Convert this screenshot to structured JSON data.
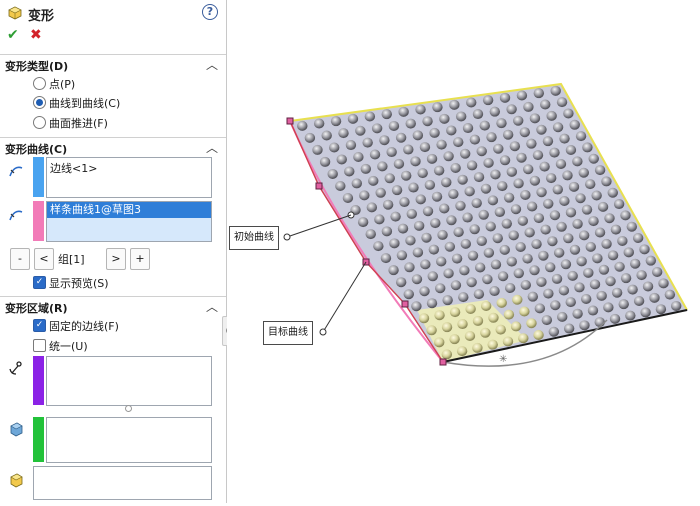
{
  "header": {
    "title": "变形",
    "help_label": "?"
  },
  "actions": {
    "ok_symbol": "✔",
    "cancel_symbol": "✖"
  },
  "deform_type": {
    "heading": "变形类型(D)",
    "options": [
      {
        "label": "点(P)",
        "selected": false
      },
      {
        "label": "曲线到曲线(C)",
        "selected": true
      },
      {
        "label": "曲面推进(F)",
        "selected": false
      }
    ]
  },
  "deform_curves": {
    "heading": "变形曲线(C)",
    "initial_list": [
      "边线<1>"
    ],
    "target_list": [
      "样条曲线1@草图3"
    ],
    "group_label": "组[1]",
    "btn_minus": "-",
    "btn_prev": "<",
    "btn_next": ">",
    "btn_plus": "+",
    "show_preview_label": "显示预览(S)",
    "show_preview_checked": true,
    "initial_color": "#49a3f0",
    "target_color": "#f27bb8"
  },
  "deform_region": {
    "heading": "变形区域(R)",
    "fixed_edges_label": "固定的边线(F)",
    "fixed_edges_checked": true,
    "uniform_label": "统一(U)",
    "uniform_checked": false,
    "color1": "#8b22e6",
    "color2": "#22c23a"
  },
  "viewport": {
    "initial_curve_label": "初始曲线",
    "target_curve_label": "目标曲线"
  }
}
